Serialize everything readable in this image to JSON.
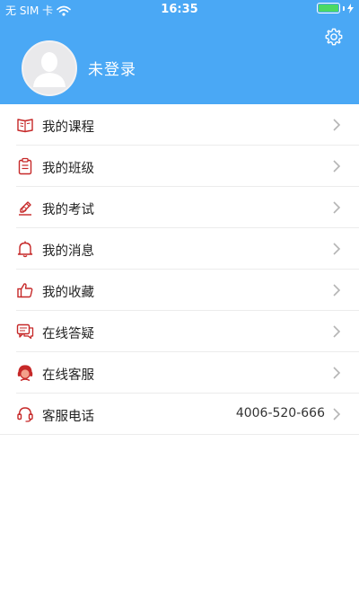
{
  "status_bar": {
    "carrier": "无 SIM 卡",
    "time": "16:35",
    "battery_percent": 100,
    "signal_icon": "wifi-icon",
    "charging_icon": "charging-bolt-icon"
  },
  "profile": {
    "name": "未登录",
    "avatar_icon": "default-avatar-icon",
    "settings_icon": "gear-icon"
  },
  "colors": {
    "header": "#4aa8f5",
    "icon_accent": "#c62828",
    "battery": "#4cd964"
  },
  "menu": {
    "items": [
      {
        "label": "我的课程",
        "icon": "book-icon",
        "value": ""
      },
      {
        "label": "我的班级",
        "icon": "clipboard-icon",
        "value": ""
      },
      {
        "label": "我的考试",
        "icon": "exam-pencil-icon",
        "value": ""
      },
      {
        "label": "我的消息",
        "icon": "bell-icon",
        "value": ""
      },
      {
        "label": "我的收藏",
        "icon": "thumbs-up-icon",
        "value": ""
      },
      {
        "label": "在线答疑",
        "icon": "chat-icon",
        "value": ""
      },
      {
        "label": "在线客服",
        "icon": "customer-service-icon",
        "value": ""
      },
      {
        "label": "客服电话",
        "icon": "headset-icon",
        "value": "4006-520-666"
      }
    ]
  }
}
